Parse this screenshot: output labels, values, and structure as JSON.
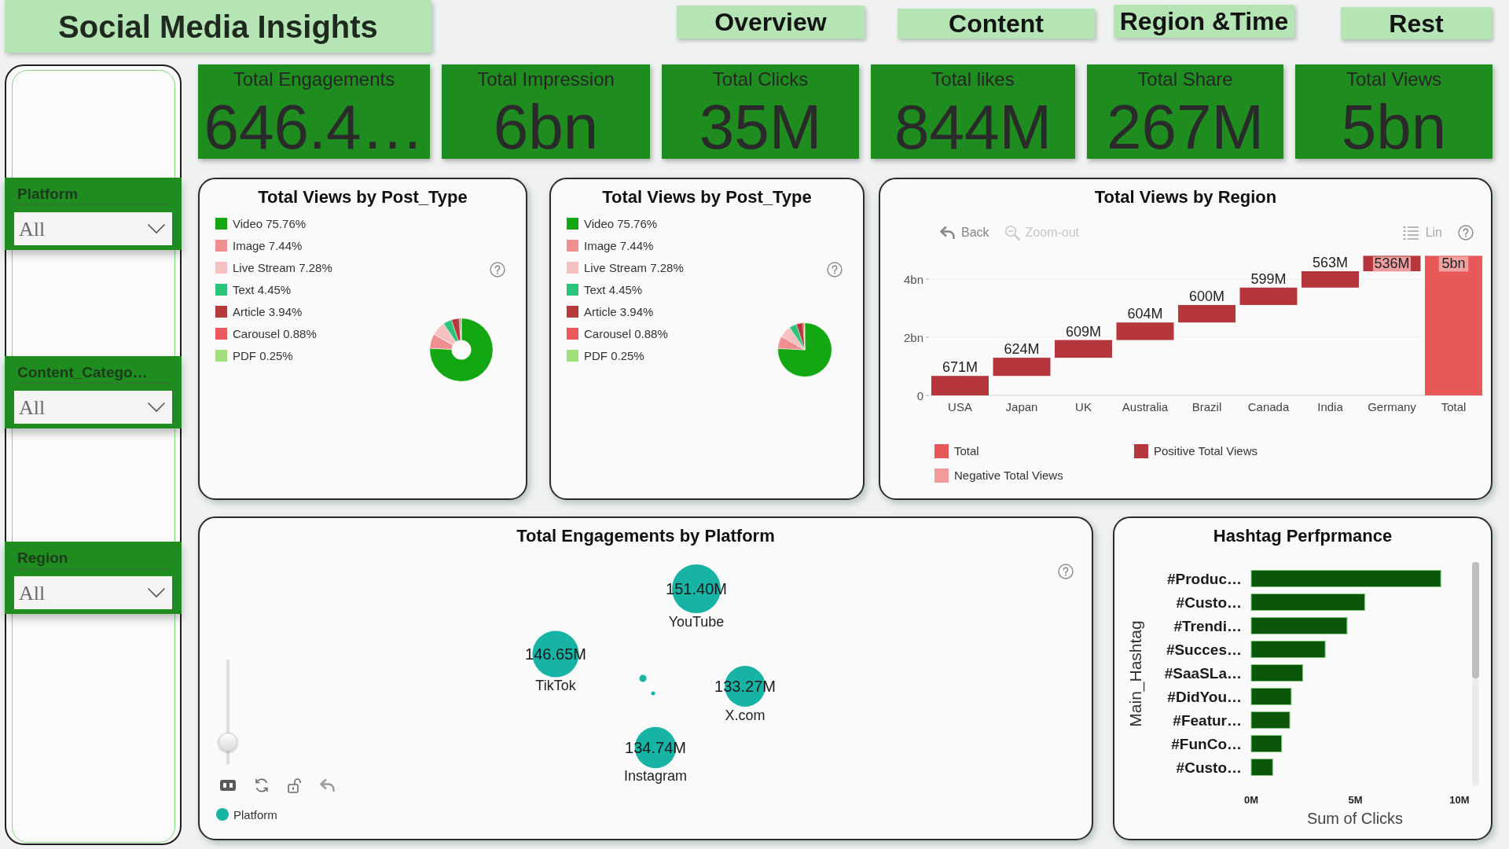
{
  "header": {
    "title": "Social Media Insights"
  },
  "nav": [
    {
      "label": "Overview"
    },
    {
      "label": "Content"
    },
    {
      "label": "Region &Time"
    },
    {
      "label": "Rest"
    }
  ],
  "slicers": [
    {
      "label": "Platform",
      "value": "All"
    },
    {
      "label": "Content_Catego…",
      "value": "All"
    },
    {
      "label": "Region",
      "value": "All"
    }
  ],
  "kpis": [
    {
      "label": "Total Engagements",
      "value": "646.4…"
    },
    {
      "label": "Total Impression",
      "value": "6bn"
    },
    {
      "label": "Total Clicks",
      "value": "35M"
    },
    {
      "label": "Total likes",
      "value": "844M"
    },
    {
      "label": "Total Share",
      "value": "267M"
    },
    {
      "label": "Total Views",
      "value": "5bn"
    }
  ],
  "post_type_charts": [
    {
      "chart_data": {
        "type": "donut",
        "title": "Total Views by Post_Type",
        "categories": [
          "Video",
          "Image",
          "Live Stream",
          "Text",
          "Article",
          "Carousel",
          "PDF"
        ],
        "values": [
          75.76,
          7.44,
          7.28,
          4.45,
          3.94,
          0.88,
          0.25
        ],
        "value_labels": [
          "75.76%",
          "7.44%",
          "7.28%",
          "4.45%",
          "3.94%",
          "0.88%",
          "0.25%"
        ],
        "colors": [
          "#13a813",
          "#f08f8f",
          "#f8c1c1",
          "#2bc47a",
          "#b53b3b",
          "#ea5a5a",
          "#9fe07d"
        ],
        "legend": true
      }
    },
    {
      "chart_data": {
        "type": "pie",
        "title": "Total Views by Post_Type",
        "categories": [
          "Video",
          "Image",
          "Live Stream",
          "Text",
          "Article",
          "Carousel",
          "PDF"
        ],
        "values": [
          75.76,
          7.44,
          7.28,
          4.45,
          3.94,
          0.88,
          0.25
        ],
        "value_labels": [
          "75.76%",
          "7.44%",
          "7.28%",
          "4.45%",
          "3.94%",
          "0.88%",
          "0.25%"
        ],
        "colors": [
          "#13a813",
          "#f08f8f",
          "#f8c1c1",
          "#2bc47a",
          "#b53b3b",
          "#ea5a5a",
          "#9fe07d"
        ],
        "legend": true
      }
    }
  ],
  "region_chart": {
    "title": "Total Views by Region",
    "toolbar": [
      {
        "kind": "back",
        "label": "Back",
        "disabled": false
      },
      {
        "kind": "zoom_out",
        "label": "Zoom-out",
        "disabled": true
      }
    ],
    "scale_toggle": {
      "label": "Lin"
    },
    "y_tick_labels": [
      "4bn",
      "2bn",
      "0"
    ],
    "bars": [
      {
        "label": "USA",
        "value": "671M",
        "kind": "increase"
      },
      {
        "label": "Japan",
        "value": "624M",
        "kind": "increase"
      },
      {
        "label": "UK",
        "value": "609M",
        "kind": "increase"
      },
      {
        "label": "Australia",
        "value": "604M",
        "kind": "increase"
      },
      {
        "label": "Brazil",
        "value": "600M",
        "kind": "increase"
      },
      {
        "label": "Canada",
        "value": "599M",
        "kind": "increase"
      },
      {
        "label": "India",
        "value": "563M",
        "kind": "increase"
      },
      {
        "label": "Germany",
        "value": "536M",
        "kind": "increase"
      },
      {
        "label": "Total",
        "value": "5bn",
        "kind": "total"
      }
    ],
    "legend": [
      {
        "kind": "total",
        "label": "Total",
        "color": "#e85858"
      },
      {
        "kind": "increase",
        "label": "Positive Total Views",
        "color": "#b5373b"
      },
      {
        "kind": "decrease",
        "label": "Negative Total Views",
        "color": "#f29a9c"
      }
    ]
  },
  "platform_chart": {
    "title": "Total Engagements by Platform",
    "zoom_slider": {
      "level": 0.22
    },
    "bubbles": [
      {
        "label": "YouTube",
        "value": "151.40M"
      },
      {
        "label": "TikTok",
        "value": "146.65M"
      },
      {
        "label": "X.com",
        "value": "133.27M"
      },
      {
        "label": "Instagram",
        "value": "134.74M"
      }
    ],
    "legend": {
      "label": "Platform"
    }
  },
  "hashtag_chart": {
    "chart_data": {
      "type": "bar",
      "orientation": "horizontal",
      "title": "Hashtag Perfprmance",
      "xlabel": "Sum of Clicks",
      "ylabel": "Main_Hashtag",
      "categories": [
        "#Produc…",
        "#Custo…",
        "#Trendi…",
        "#Succes…",
        "#SaaSLa…",
        "#DidYou…",
        "#Featur…",
        "#FunCo…",
        "#Custo…"
      ],
      "values": [
        9.1,
        5.45,
        4.6,
        3.55,
        2.47,
        1.92,
        1.85,
        1.46,
        1.03
      ],
      "xlim": [
        0,
        10
      ],
      "xticks": [
        {
          "value": 0,
          "label": "0M"
        },
        {
          "value": 5,
          "label": "5M"
        },
        {
          "value": 10,
          "label": "10M"
        }
      ]
    }
  }
}
